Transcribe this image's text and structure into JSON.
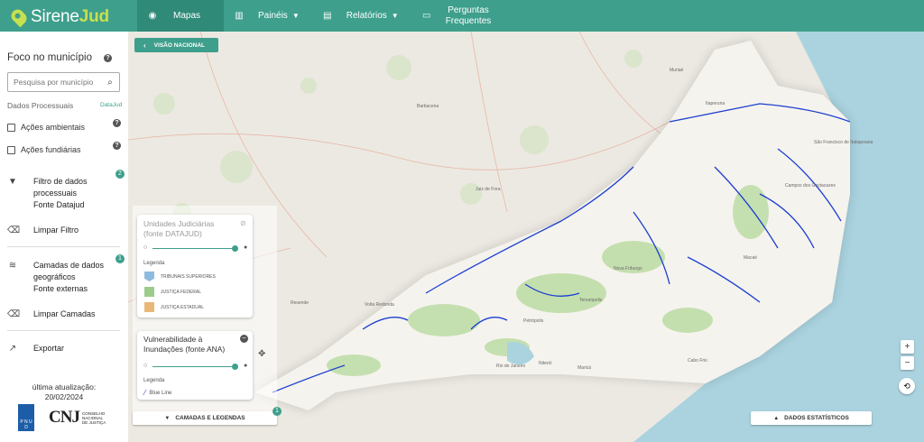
{
  "app": {
    "logo_prefix": "Sirene",
    "logo_suffix": "Jud"
  },
  "nav": [
    {
      "icon": "globe-icon",
      "glyph": "◉",
      "label": "Mapas"
    },
    {
      "icon": "bar-chart-icon",
      "glyph": "▥",
      "label": "Painéis"
    },
    {
      "icon": "document-icon",
      "glyph": "▤",
      "label": "Relatórios"
    },
    {
      "icon": "chat-icon",
      "glyph": "▭",
      "label_1": "Perguntas",
      "label_2": "Frequentes"
    }
  ],
  "sidebar": {
    "title": "Foco no município",
    "search_placeholder": "Pesquisa por município",
    "dados_label": "Dados Processuais",
    "dados_source": "DataJud",
    "checkboxes": [
      "Ações ambientais",
      "Ações fundiárias"
    ],
    "filtro": {
      "l1": "Filtro de dados",
      "l2": "processuais",
      "l3": "Fonte Datajud",
      "badge": "2"
    },
    "limpar_filtro": "Limpar Filtro",
    "camadas": {
      "l1": "Camadas de dados",
      "l2": "geográficos",
      "l3": "Fonte externas",
      "badge": "1"
    },
    "limpar_camadas": "Limpar Camadas",
    "exportar": "Exportar",
    "update_label": "última atualização:",
    "update_date": "20/02/2024",
    "pnud_text": "P N U D",
    "cnj_text": "CNJ",
    "cnj_sub_1": "CONSELHO",
    "cnj_sub_2": "NACIONAL",
    "cnj_sub_3": "DE JUSTIÇA"
  },
  "map": {
    "visao_nacional": "VISÃO NACIONAL",
    "layer1": {
      "title_1": "Unidades Judiciárias",
      "title_2": "(fonte DATAJUD)",
      "legend_title": "Legenda",
      "items": [
        {
          "label": "TRIBUNAIS SUPERIORES",
          "color": "#8dbbe0"
        },
        {
          "label": "JUSTIÇA FEDERAL",
          "color": "#9ccc8c"
        },
        {
          "label": "JUSTIÇA ESTADUAL",
          "color": "#e8b878"
        }
      ]
    },
    "layer2": {
      "title_1": "Vulnerabilidade à",
      "title_2": "Inundações (fonte ANA)",
      "legend_title": "Legenda",
      "line_label": "Blue Line"
    },
    "camadas_btn": "CAMADAS E LEGENDAS",
    "camadas_badge": "1",
    "dados_btn": "DADOS ESTATÍSTICOS",
    "zoom_in": "+",
    "zoom_out": "−",
    "places": [
      "Juiz de Fora",
      "Barbacena",
      "Campos dos Goytacazes",
      "Petrópolis",
      "Nova Friburgo",
      "Niterói",
      "Rio de Janeiro",
      "Macaé",
      "Cabo Frio",
      "Resende",
      "Volta Redonda",
      "Teresópolis",
      "Itaperuna",
      "São Francisco de Itabapoana",
      "Muriaé",
      "Maricá"
    ]
  }
}
